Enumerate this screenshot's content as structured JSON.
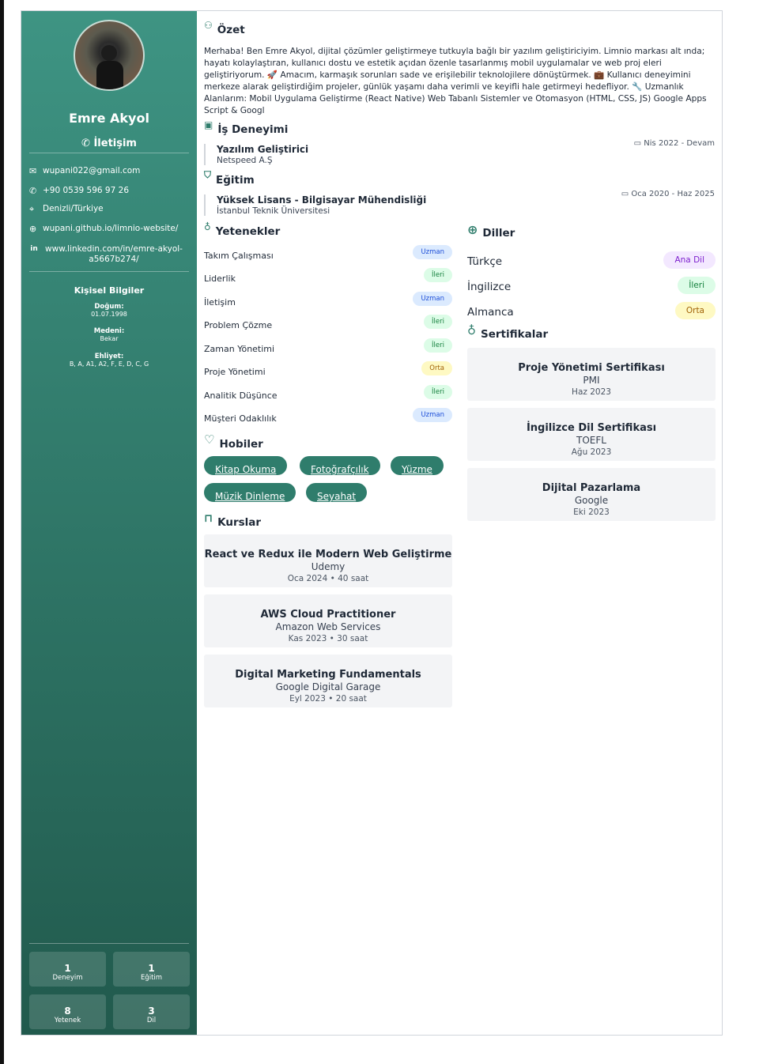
{
  "profile": {
    "name": "Emre Akyol",
    "contact_title": "İletişim",
    "email": "wupani022@gmail.com",
    "phone": "+90 0539 596 97 26",
    "location": "Denizli/Türkiye",
    "website": "wupani.github.io/limnio-website/",
    "linkedin": "www.linkedin.com/in/emre-akyol-a5667b274/"
  },
  "personal": {
    "title": "Kişisel Bilgiler",
    "birth_label": "Doğum:",
    "birth_value": "01.07.1998",
    "marital_label": "Medeni:",
    "marital_value": "Bekar",
    "license_label": "Ehliyet:",
    "license_value": "B, A, A1, A2, F, E, D, C, G"
  },
  "stats": [
    {
      "num": "1",
      "label": "Deneyim"
    },
    {
      "num": "1",
      "label": "Eğitim"
    },
    {
      "num": "8",
      "label": "Yetenek"
    },
    {
      "num": "3",
      "label": "Dil"
    }
  ],
  "summary": {
    "title": "Özet",
    "text": "Merhaba! Ben Emre Akyol, dijital çözümler geliştirmeye tutkuyla bağlı bir yazılım geliştiriciyim. Limnio markası alt ında; hayatı kolaylaştıran, kullanıcı dostu ve estetik açıdan özenle tasarlanmış mobil uygulamalar ve web proj eleri geliştiriyorum. 🚀 Amacım, karmaşık sorunları sade ve erişilebilir teknolojilere dönüştürmek. 💼 Kullanıcı deneyimini merkeze alarak geliştirdiğim projeler, günlük yaşamı daha verimli ve keyifli hale getirmeyi hedefliyor. 🔧 Uzmanlık Alanlarım: Mobil Uygulama Geliştirme (React Native) Web Tabanlı Sistemler ve Otomasyon (HTML, CSS, JS) Google Apps Script & Googl"
  },
  "experience": {
    "title": "İş Deneyimi",
    "items": [
      {
        "role": "Yazılım Geliştirici",
        "company": "Netspeed A.Ş",
        "date": "Nis 2022 - Devam"
      }
    ]
  },
  "education": {
    "title": "Eğitim",
    "items": [
      {
        "degree": "Yüksek Lisans - Bilgisayar Mühendisliği",
        "school": "İstanbul Teknik Üniversitesi",
        "date": "Oca 2020 - Haz 2025"
      }
    ]
  },
  "skills": {
    "title": "Yetenekler",
    "items": [
      {
        "name": "Takım Çalışması",
        "level": "Uzman"
      },
      {
        "name": "Liderlik",
        "level": "İleri"
      },
      {
        "name": "İletişim",
        "level": "Uzman"
      },
      {
        "name": "Problem Çözme",
        "level": "İleri"
      },
      {
        "name": "Zaman Yönetimi",
        "level": "İleri"
      },
      {
        "name": "Proje Yönetimi",
        "level": "Orta"
      },
      {
        "name": "Analitik Düşünce",
        "level": "İleri"
      },
      {
        "name": "Müşteri Odaklılık",
        "level": "Uzman"
      }
    ]
  },
  "languages": {
    "title": "Diller",
    "items": [
      {
        "name": "Türkçe",
        "level": "Ana Dil"
      },
      {
        "name": "İngilizce",
        "level": "İleri"
      },
      {
        "name": "Almanca",
        "level": "Orta"
      }
    ]
  },
  "hobbies": {
    "title": "Hobiler",
    "items": [
      "Kitap Okuma",
      "Fotoğrafçılık",
      "Yüzme",
      "Müzik Dinleme",
      "Seyahat"
    ]
  },
  "certificates": {
    "title": "Sertifikalar",
    "items": [
      {
        "name": "Proje Yönetimi Sertifikası",
        "issuer": "PMI",
        "date": "Haz 2023"
      },
      {
        "name": "İngilizce Dil Sertifikası",
        "issuer": "TOEFL",
        "date": "Ağu 2023"
      },
      {
        "name": "Dijital Pazarlama",
        "issuer": "Google",
        "date": "Eki 2023"
      }
    ]
  },
  "courses": {
    "title": "Kurslar",
    "items": [
      {
        "name": "React ve Redux ile Modern Web Geliştirme",
        "provider": "Udemy",
        "date": "Oca 2024",
        "duration": "• 40 saat"
      },
      {
        "name": "AWS Cloud Practitioner",
        "provider": "Amazon Web Services",
        "date": "Kas 2023",
        "duration": "• 30 saat"
      },
      {
        "name": "Digital Marketing Fundamentals",
        "provider": "Google Digital Garage",
        "date": "Eyl 2023",
        "duration": "• 20 saat"
      }
    ]
  },
  "icons": {
    "summary": "user-icon",
    "experience": "briefcase-icon",
    "education": "graduation-cap-icon",
    "skills": "award-icon",
    "languages": "globe-icon",
    "certificates": "award-icon",
    "hobbies": "heart-icon",
    "courses": "book-icon"
  },
  "colors": {
    "accent": "#2f7d6c",
    "sidebar_top": "#3e9483",
    "sidebar_bottom": "#215a4d"
  }
}
